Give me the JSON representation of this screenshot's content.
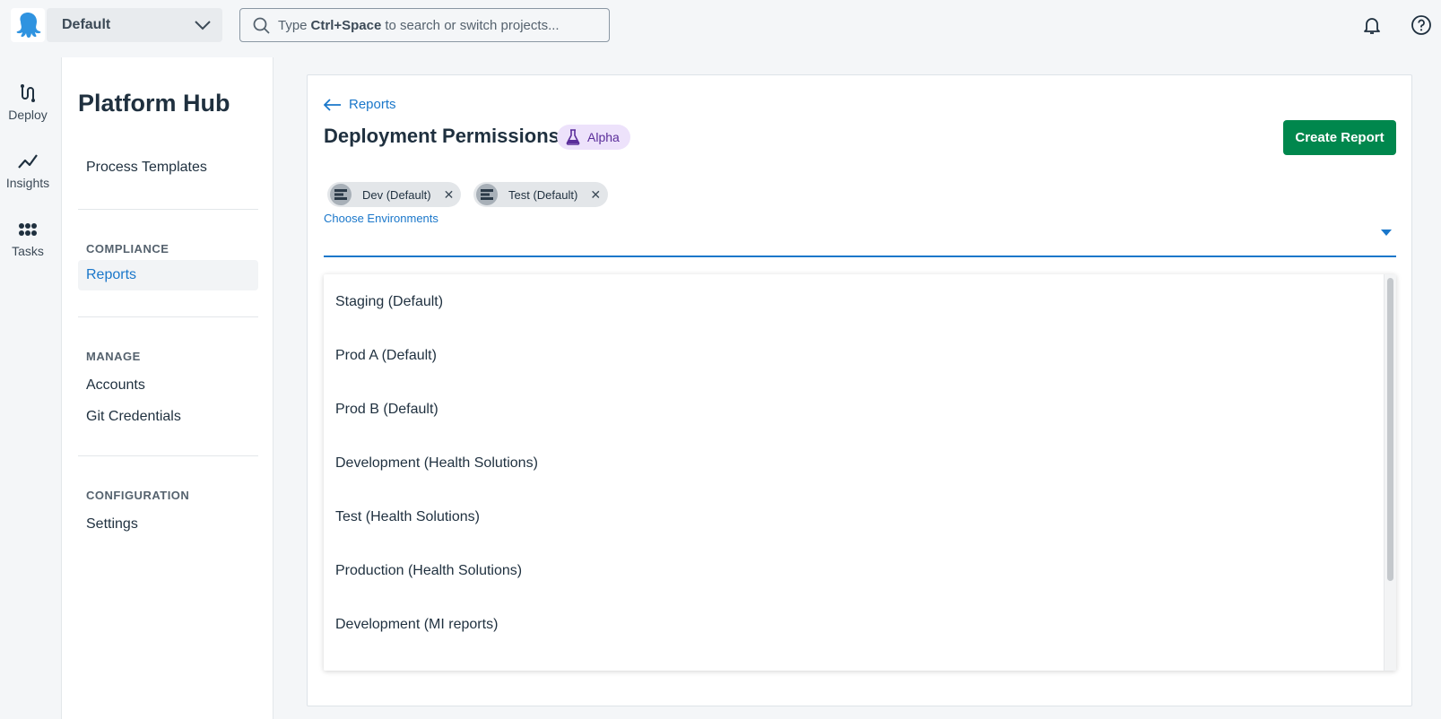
{
  "topbar": {
    "space_name": "Default",
    "search_prefix": "Type",
    "search_shortcut": "Ctrl+Space",
    "search_suffix": "to search or switch projects..."
  },
  "rail": {
    "items": [
      {
        "label": "Deploy",
        "icon": "deploy-icon"
      },
      {
        "label": "Insights",
        "icon": "insights-icon"
      },
      {
        "label": "Tasks",
        "icon": "tasks-icon"
      }
    ]
  },
  "sidebar": {
    "title": "Platform Hub",
    "process_templates": "Process Templates",
    "compliance_heading": "COMPLIANCE",
    "reports": "Reports",
    "manage_heading": "MANAGE",
    "accounts": "Accounts",
    "git_credentials": "Git Credentials",
    "configuration_heading": "CONFIGURATION",
    "settings": "Settings"
  },
  "main": {
    "back_label": "Reports",
    "title": "Deployment Permissions",
    "badge": "Alpha",
    "create_button": "Create Report",
    "chips": [
      {
        "label": "Dev (Default)"
      },
      {
        "label": "Test (Default)"
      }
    ],
    "field_label": "Choose Environments",
    "options": [
      "Staging (Default)",
      "Prod A (Default)",
      "Prod B (Default)",
      "Development (Health Solutions)",
      "Test (Health Solutions)",
      "Production (Health Solutions)",
      "Development (MI reports)"
    ]
  },
  "colors": {
    "accent": "#1a77ca",
    "primary_button": "#00874d",
    "badge_bg": "#ede2fb",
    "badge_text": "#5a2d9a"
  }
}
